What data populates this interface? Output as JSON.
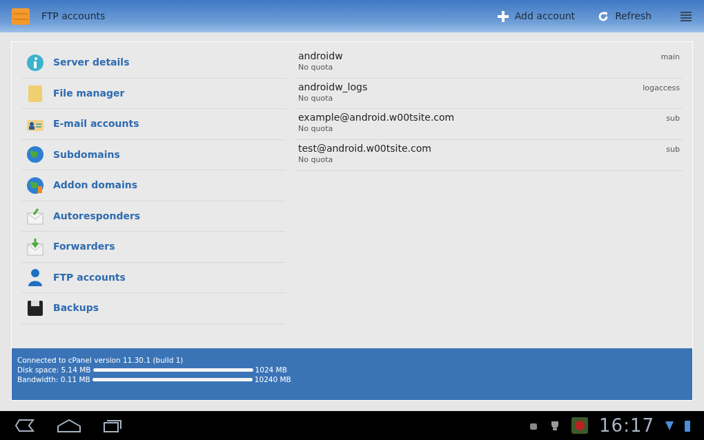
{
  "action_bar": {
    "title": "FTP accounts",
    "actions": [
      {
        "label": "Add account"
      },
      {
        "label": "Refresh"
      }
    ]
  },
  "menu": [
    {
      "label": "Server details"
    },
    {
      "label": "File manager"
    },
    {
      "label": "E-mail accounts"
    },
    {
      "label": "Subdomains"
    },
    {
      "label": "Addon domains"
    },
    {
      "label": "Autoresponders"
    },
    {
      "label": "Forwarders"
    },
    {
      "label": "FTP accounts"
    },
    {
      "label": "Backups"
    }
  ],
  "accounts": [
    {
      "name": "androidw",
      "quota": "No quota",
      "type": "main"
    },
    {
      "name": "androidw_logs",
      "quota": "No quota",
      "type": "logaccess"
    },
    {
      "name": "example@android.w00tsite.com",
      "quota": "No quota",
      "type": "sub"
    },
    {
      "name": "test@android.w00tsite.com",
      "quota": "No quota",
      "type": "sub"
    }
  ],
  "status": {
    "connection": "Connected to cPanel version 11.30.1 (build 1)",
    "meters": [
      {
        "label": "Disk space: 5.14 MB",
        "level": 0.005,
        "max": "1024 MB"
      },
      {
        "label": "Bandwidth: 0.11 MB",
        "level": 0.0001,
        "max": "10240 MB"
      }
    ]
  },
  "system_bar": {
    "time": "16:17"
  }
}
